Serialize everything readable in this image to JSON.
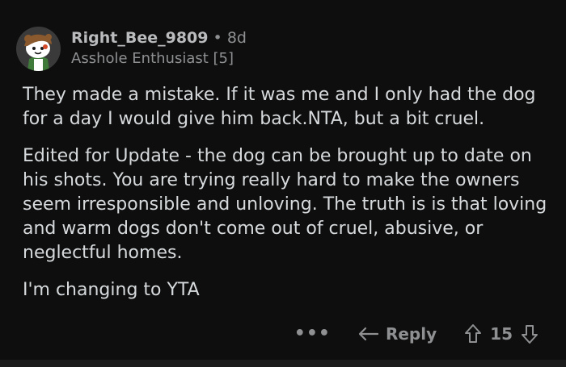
{
  "comment": {
    "username": "Right_Bee_9809",
    "separator": "•",
    "age": "8d",
    "flair": "Asshole Enthusiast [5]",
    "avatar_icon": "snoo-avatar-icon",
    "paragraphs": [
      "They made a mistake. If it was me and I only had the dog for a day I would give him back.NTA, but a bit cruel.",
      "Edited for Update - the dog can be brought up to date on his shots. You are trying really hard to make the owners seem irresponsible and unloving. The truth is is that loving and warm dogs don't come out of cruel, abusive, or neglectful homes.",
      "I'm changing to YTA"
    ]
  },
  "actions": {
    "more_label": "•••",
    "reply_label": "Reply",
    "vote_count": "15"
  },
  "colors": {
    "background": "#0e0e0e",
    "text": "#d7dadc",
    "muted": "#8e9092"
  }
}
